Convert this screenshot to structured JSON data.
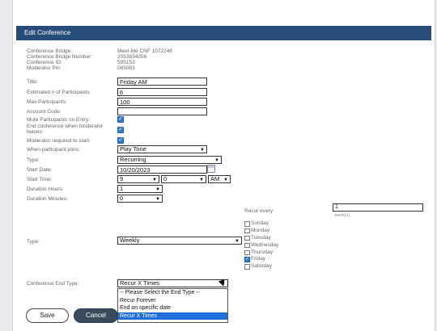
{
  "header": {
    "title": "Edit Conference"
  },
  "info": [
    {
      "label": "Conference Bridge:",
      "value": "Meet-Me CNF 1072248"
    },
    {
      "label": "Conference Bridge Number:",
      "value": "2053834256"
    },
    {
      "label": "Conference ID:",
      "value": "595153"
    },
    {
      "label": "Moderator Pin:",
      "value": "065083"
    }
  ],
  "form": {
    "title_label": "Title:",
    "title_value": "Friday AM",
    "est_label": "Estimated # of Participants:",
    "est_value": "6",
    "max_label": "Max Participants:",
    "max_value": "100",
    "account_label": "Account Code:",
    "account_value": "",
    "mute_label": "Mute Participants on Entry:",
    "mute_checked": true,
    "end_label": "End conference when moderator leaves:",
    "end_checked": true,
    "modreq_label": "Moderator required to start:",
    "modreq_checked": true,
    "join_label": "When participant joins:",
    "join_value": "Play Tone",
    "type_label": "Type:",
    "type_value": "Recurring",
    "start_date_label": "Start Date:",
    "start_date_value": "10/20/2023",
    "start_time_label": "Start Time:",
    "hour_value": "9",
    "minute_value": "0",
    "ampm_value": "AM",
    "dur_hours_label": "Duration Hours:",
    "dur_hours_value": "1",
    "dur_min_label": "Duration Minutes:",
    "dur_min_value": "0",
    "recur_type_label": "Type:",
    "recur_type_value": "Weekly",
    "end_type_label": "Conference End Type:",
    "end_type_value": "Recur X Times"
  },
  "recur": {
    "every_label": "Recur every:",
    "every_value": "1",
    "unit": "week(s)",
    "days": [
      {
        "name": "Sunday",
        "checked": false
      },
      {
        "name": "Monday",
        "checked": false
      },
      {
        "name": "Tuesday",
        "checked": false
      },
      {
        "name": "Wednesday",
        "checked": false
      },
      {
        "name": "Thursday",
        "checked": false
      },
      {
        "name": "Friday",
        "checked": true
      },
      {
        "name": "Saturday",
        "checked": false
      }
    ]
  },
  "end_type_options": [
    {
      "label": "-- Please Select the End Type --",
      "selected": false
    },
    {
      "label": "Recur Forever",
      "selected": false
    },
    {
      "label": "End on specific date",
      "selected": false
    },
    {
      "label": "Recur X Times",
      "selected": true
    }
  ],
  "buttons": {
    "save": "Save",
    "cancel": "Cancel"
  },
  "colors": {
    "header_bg": "#264d7a",
    "checkbox": "#2e7bd8",
    "selected_option": "#1e6fd9",
    "cancel_bg": "#3a4b5e"
  }
}
